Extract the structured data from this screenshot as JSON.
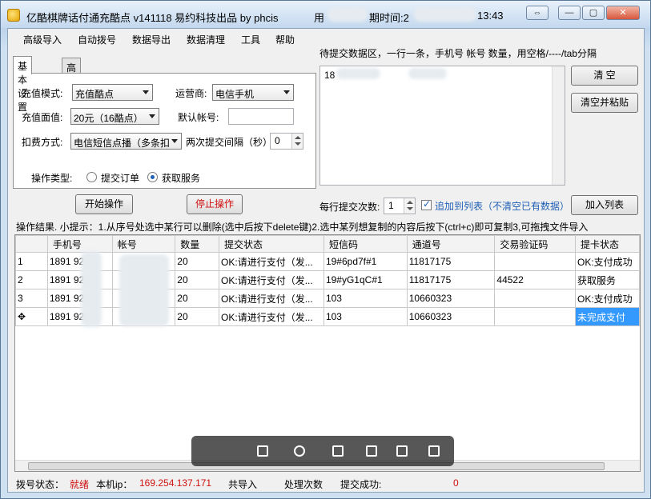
{
  "window": {
    "title": "亿酷棋牌话付通充酷点 v141118    易约科技出品  by phcis",
    "title_suffix": "用",
    "clock_prefix": "期时间:2",
    "clock_time": "13:43"
  },
  "menu": [
    "高级导入",
    "自动拨号",
    "数据导出",
    "数据清理",
    "工具",
    "帮助"
  ],
  "tabs": [
    "基本设置",
    "高级设置"
  ],
  "settings": {
    "mode_label": "充值模式:",
    "mode_value": "充值酷点",
    "carrier_label": "运营商:",
    "carrier_value": "电信手机",
    "amount_label": "充值面值:",
    "amount_value": "20元（16酷点）",
    "default_account_label": "默认帐号:",
    "default_account_value": "",
    "deduct_label": "扣费方式:",
    "deduct_value": "电信短信点播（多条扣",
    "interval_label": "两次提交间隔（秒）:",
    "interval_value": "0",
    "op_type_label": "操作类型:",
    "op_submit_order": "提交订单",
    "op_get_service": "获取服务",
    "selected_op": "获取服务"
  },
  "buttons": {
    "start": "开始操作",
    "stop": "停止操作",
    "clear": "清  空",
    "clear_paste": "清空并粘贴",
    "add_list": "加入列表"
  },
  "submit": {
    "label": "待提交数据区，一行一条，手机号 帐号 数量，用空格/----/tab分隔",
    "content": "18",
    "per_submit_label": "每行提交次数:",
    "per_submit_value": "1",
    "append_label": "追加到列表（不清空已有数据）",
    "append_checked": true
  },
  "hint": "操作结果. 小提示：1.从序号处选中某行可以删除(选中后按下delete键)2.选中某列想复制的内容后按下(ctrl+c)即可复制3,可拖拽文件导入",
  "table": {
    "columns": [
      "",
      "手机号",
      "帐号",
      "数量",
      "提交状态",
      "短信码",
      "通道号",
      "交易验证码",
      "提卡状态"
    ],
    "rows": [
      [
        "1",
        "1891   9285",
        "",
        "20",
        "OK:请进行支付（发...",
        "19#6pd7f#1",
        "11817175",
        "",
        "OK:支付成功"
      ],
      [
        "2",
        "1891   9285",
        "",
        "20",
        "OK:请进行支付（发...",
        "19#yG1qC#1",
        "11817175",
        "44522",
        "获取服务"
      ],
      [
        "3",
        "1891   9285",
        "",
        "20",
        "OK:请进行支付（发...",
        "103",
        "10660323",
        "",
        "OK:支付成功"
      ],
      [
        "✥",
        "1891   9285",
        "",
        "20",
        "OK:请进行支付（发...",
        "103",
        "10660323",
        "",
        "未完成支付"
      ]
    ]
  },
  "status": {
    "dial_label": "拨号状态：",
    "dial_value": "就绪",
    "ip_label": "本机ip：",
    "ip_value": "169.254.137.171",
    "import_label": "共导入",
    "processed_label": "处理次数",
    "submitted_label": "提交成功:",
    "submitted_value": "0"
  },
  "colors": {
    "status_red": "#d01010",
    "selection_blue": "#3399ff",
    "link_blue": "#1f5fb5"
  }
}
